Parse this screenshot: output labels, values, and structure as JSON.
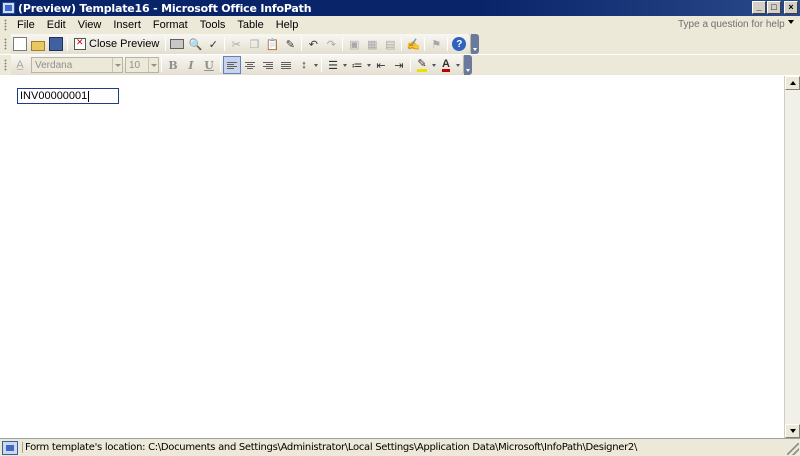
{
  "window": {
    "title": "(Preview) Template16 - Microsoft Office InfoPath",
    "controls": {
      "minimize": "_",
      "maximize": "□",
      "close": "×"
    }
  },
  "menubar": {
    "items": [
      {
        "label": "File",
        "accel": "F"
      },
      {
        "label": "Edit",
        "accel": "E"
      },
      {
        "label": "View",
        "accel": "V"
      },
      {
        "label": "Insert",
        "accel": "I"
      },
      {
        "label": "Format",
        "accel": "o"
      },
      {
        "label": "Tools",
        "accel": "T"
      },
      {
        "label": "Table",
        "accel": "a"
      },
      {
        "label": "Help",
        "accel": "H"
      }
    ],
    "help_placeholder": "Type a question for help"
  },
  "toolbar_standard": {
    "close_preview_label": "Close Preview",
    "icons": [
      "new-icon",
      "open-icon",
      "save-icon",
      "print-icon",
      "print-preview-icon",
      "spelling-icon",
      "cut-icon",
      "copy-icon",
      "paste-icon",
      "format-painter-icon",
      "undo-icon",
      "redo-icon",
      "insert-picture-icon",
      "table-icon",
      "design-tasks-icon",
      "signature-icon",
      "permission-icon",
      "help-icon"
    ]
  },
  "toolbar_formatting": {
    "font_name": "Verdana",
    "font_size": "10",
    "bold": "B",
    "italic": "I",
    "underline": "U",
    "highlight_icon": "highlight-icon",
    "font_color_icon": "font-color-icon",
    "font_color_glyph": "A"
  },
  "form": {
    "invoice_number": "INV00000001"
  },
  "statusbar": {
    "text": "Form template's location: C:\\Documents and Settings\\Administrator\\Local Settings\\Application Data\\Microsoft\\InfoPath\\Designer2\\"
  },
  "colors": {
    "title_bar": "#0a246a",
    "chrome": "#ece9d8",
    "field_border": "#1c3c8c"
  }
}
